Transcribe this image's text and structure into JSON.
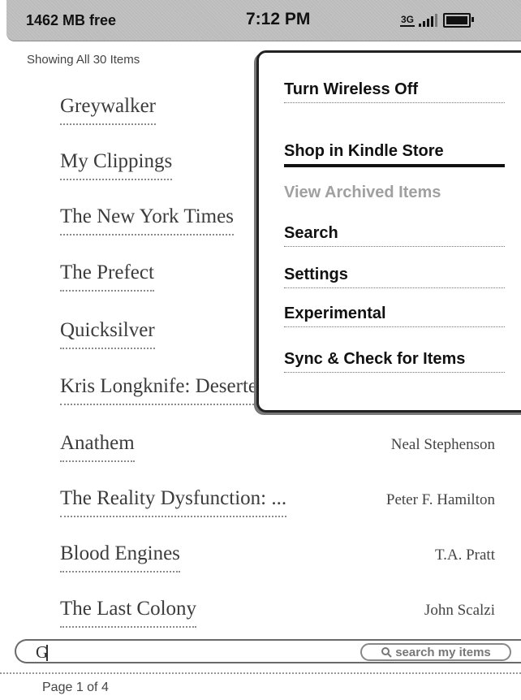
{
  "status": {
    "free_space": "1462 MB free",
    "time": "7:12 PM",
    "network_label": "3G",
    "icons": [
      "3g-icon",
      "signal-strength-icon",
      "battery-icon"
    ]
  },
  "library": {
    "showing": "Showing All 30 Items",
    "items": [
      {
        "title": "Greywalker",
        "author": ""
      },
      {
        "title": "My Clippings",
        "author": ""
      },
      {
        "title": "The New York Times",
        "author": ""
      },
      {
        "title": "The Prefect",
        "author": ""
      },
      {
        "title": "Quicksilver",
        "author": ""
      },
      {
        "title": "Kris Longknife: Deserter",
        "author": ""
      },
      {
        "title": "Anathem",
        "author": "Neal Stephenson"
      },
      {
        "title": "The Reality Dysfunction: ...",
        "author": "Peter F. Hamilton"
      },
      {
        "title": "Blood Engines",
        "author": "T.A. Pratt"
      },
      {
        "title": "The Last Colony",
        "author": "John Scalzi"
      }
    ]
  },
  "search": {
    "value": "G",
    "button_label": "search my items"
  },
  "page_indicator": "Page 1 of 4",
  "menu": {
    "items": [
      {
        "label": "Turn Wireless Off"
      },
      {
        "label": "Shop in Kindle Store",
        "selected": true
      },
      {
        "label": "View Archived Items",
        "disabled": true
      },
      {
        "label": "Search"
      },
      {
        "label": "Settings"
      },
      {
        "label": "Experimental"
      },
      {
        "label": "Sync & Check for Items"
      }
    ]
  }
}
